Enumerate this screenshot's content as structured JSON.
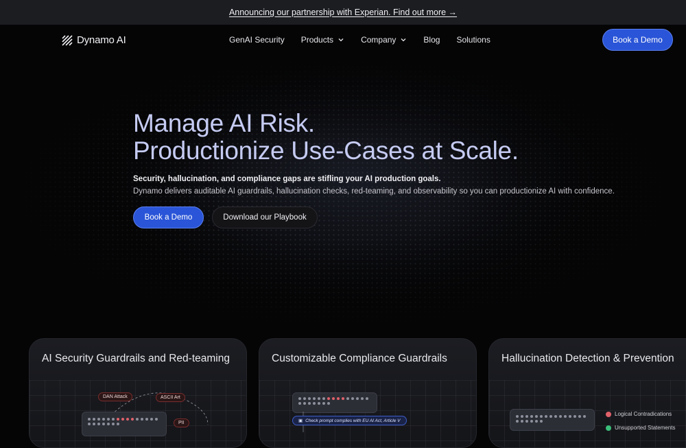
{
  "announcement": {
    "text": "Announcing our partnership with Experian. Find out more →"
  },
  "nav": {
    "logo_text": "Dynamo AI",
    "links": [
      {
        "label": "GenAI Security",
        "has_dropdown": false
      },
      {
        "label": "Products",
        "has_dropdown": true
      },
      {
        "label": "Company",
        "has_dropdown": true
      },
      {
        "label": "Blog",
        "has_dropdown": false
      },
      {
        "label": "Solutions",
        "has_dropdown": false
      }
    ],
    "cta_label": "Book a Demo"
  },
  "hero": {
    "title_line1": "Manage AI Risk.",
    "title_line2": "Productionize Use-Cases at Scale.",
    "subtitle_bold": "Security, hallucination, and compliance gaps are stifling your AI production goals.",
    "subtitle": "Dynamo delivers auditable AI guardrails, hallucination checks, red-teaming, and observability so you can productionize AI with confidence.",
    "primary_cta": "Book a Demo",
    "secondary_cta": "Download our Playbook"
  },
  "cards": [
    {
      "title": "AI Security Guardrails and Red-teaming",
      "tags": [
        "DAN Attack",
        "ASCII Art",
        "PII"
      ]
    },
    {
      "title": "Customizable Compliance Guardrails",
      "check_label": "Check prompt complies with EU AI Act, Article V"
    },
    {
      "title": "Hallucination Detection & Prevention",
      "items": [
        {
          "label": "Logical Contradications",
          "status": "fail"
        },
        {
          "label": "Unsupported Statements",
          "status": "pass"
        }
      ]
    }
  ],
  "colors": {
    "accent": "#2a55d8",
    "title_tint": "#c5cbf2",
    "alert_red": "#e0616a",
    "ok_green": "#3bbf7a"
  }
}
